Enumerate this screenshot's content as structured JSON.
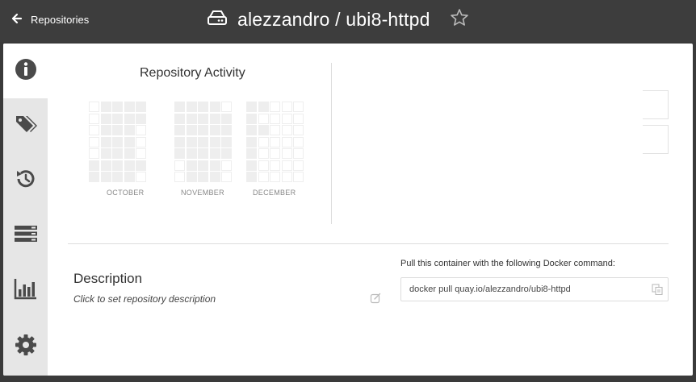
{
  "header": {
    "back_label": "Repositories",
    "repo_title": "alezzandro / ubi8-httpd",
    "back_icon": "arrow-left-icon",
    "repo_icon": "hard-drive-icon",
    "star_icon": "star-outline-icon"
  },
  "sidebar": {
    "items": [
      {
        "name": "info",
        "icon": "info-icon",
        "active": true
      },
      {
        "name": "tags",
        "icon": "tags-icon",
        "active": false
      },
      {
        "name": "history",
        "icon": "history-icon",
        "active": false
      },
      {
        "name": "builds",
        "icon": "builds-icon",
        "active": false
      },
      {
        "name": "usage",
        "icon": "bar-chart-icon",
        "active": false
      },
      {
        "name": "settings",
        "icon": "gear-icon",
        "active": false
      }
    ]
  },
  "activity": {
    "title": "Repository Activity",
    "months": [
      "OCTOBER",
      "NOVEMBER",
      "DECEMBER"
    ]
  },
  "description": {
    "heading": "Description",
    "placeholder": "Click to set repository description"
  },
  "pull": {
    "label": "Pull this container with the following Docker command:",
    "command": "docker pull quay.io/alezzandro/ubi8-httpd"
  },
  "colors": {
    "topbar": "#3d3d3d",
    "sidebar": "#e6e6e6",
    "icon": "#4a4a4a"
  }
}
